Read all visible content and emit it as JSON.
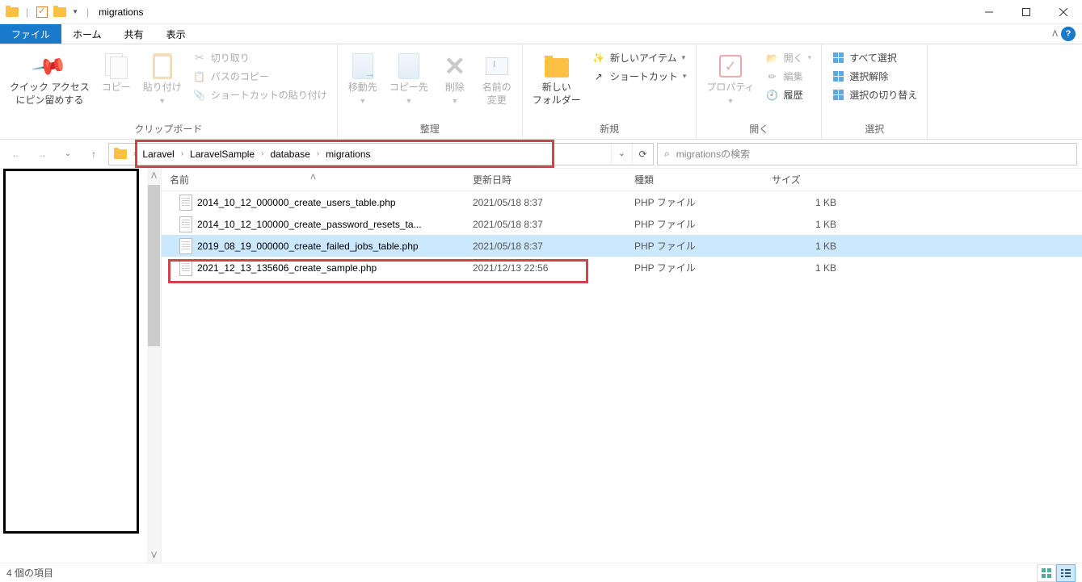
{
  "window": {
    "title": "migrations"
  },
  "tabs": {
    "file": "ファイル",
    "home": "ホーム",
    "share": "共有",
    "view": "表示"
  },
  "ribbon": {
    "clipboard": {
      "label": "クリップボード",
      "pin": "クイック アクセス\nにピン留めする",
      "copy": "コピー",
      "paste": "貼り付け",
      "cut": "切り取り",
      "copyPath": "パスのコピー",
      "pasteShortcut": "ショートカットの貼り付け"
    },
    "organize": {
      "label": "整理",
      "moveTo": "移動先",
      "copyTo": "コピー先",
      "delete": "削除",
      "rename": "名前の\n変更"
    },
    "new": {
      "label": "新規",
      "newFolder": "新しい\nフォルダー",
      "newItem": "新しいアイテム",
      "shortcut": "ショートカット"
    },
    "open": {
      "label": "開く",
      "properties": "プロパティ",
      "open": "開く",
      "edit": "編集",
      "history": "履歴"
    },
    "select": {
      "label": "選択",
      "selectAll": "すべて選択",
      "selectNone": "選択解除",
      "selectInvert": "選択の切り替え"
    }
  },
  "breadcrumb": [
    "Laravel",
    "LaravelSample",
    "database",
    "migrations"
  ],
  "search": {
    "placeholder": "migrationsの検索"
  },
  "columns": {
    "name": "名前",
    "date": "更新日時",
    "type": "種類",
    "size": "サイズ"
  },
  "files": [
    {
      "name": "2014_10_12_000000_create_users_table.php",
      "date": "2021/05/18 8:37",
      "type": "PHP ファイル",
      "size": "1 KB",
      "selected": false
    },
    {
      "name": "2014_10_12_100000_create_password_resets_ta...",
      "date": "2021/05/18 8:37",
      "type": "PHP ファイル",
      "size": "1 KB",
      "selected": false
    },
    {
      "name": "2019_08_19_000000_create_failed_jobs_table.php",
      "date": "2021/05/18 8:37",
      "type": "PHP ファイル",
      "size": "1 KB",
      "selected": true
    },
    {
      "name": "2021_12_13_135606_create_sample.php",
      "date": "2021/12/13 22:56",
      "type": "PHP ファイル",
      "size": "1 KB",
      "selected": false
    }
  ],
  "status": {
    "count": "4 個の項目"
  }
}
